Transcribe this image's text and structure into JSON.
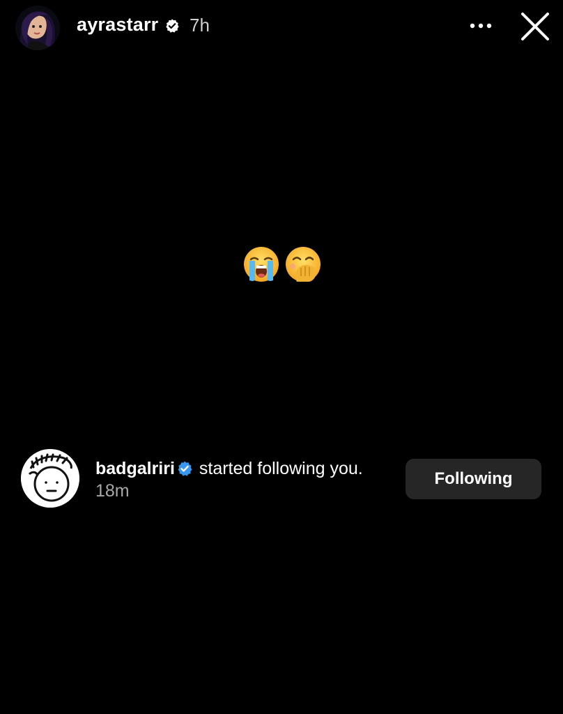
{
  "header": {
    "username": "ayrastarr",
    "time": "7h"
  },
  "story": {
    "emojis": [
      "loudly-crying-face",
      "face-with-hand-over-mouth"
    ]
  },
  "notification": {
    "username": "badgalriri",
    "message": "started following you.",
    "time": "18m",
    "button_label": "Following"
  },
  "colors": {
    "background": "#000000",
    "button_bg": "#262626",
    "verified_blue": "#3897F0",
    "muted_text": "#A8A8A8"
  }
}
